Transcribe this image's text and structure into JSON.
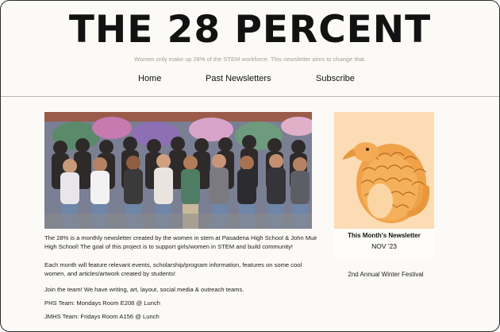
{
  "header": {
    "title": "THE 28 PERCENT",
    "tagline": "Women only make up 28% of the STEM workforce. This newsletter aims to change that."
  },
  "nav": {
    "items": [
      {
        "label": "Home"
      },
      {
        "label": "Past Newsletters"
      },
      {
        "label": "Subscribe"
      }
    ]
  },
  "main": {
    "paragraphs": [
      "The 28% is a monthly newsletter created by the women in stem at Pasadena High School & John Muir High School! The goal of this project is to support girls/women in STEM and build community!",
      "Each month will feature relevant events, scholarship/program information, features on some cool women, and articles/artwork created by students!",
      "Join the team! We have writing, art, layout, social media & outreach teams.",
      "PHS Team: Mondays Room E208 @ Lunch",
      "JMHS Team: Fridays Room A156 @ Lunch"
    ]
  },
  "sidebar": {
    "card_label": "This Month's Newsletter",
    "card_date": "NOV '23",
    "festival": "2nd Annual Winter Festival"
  }
}
